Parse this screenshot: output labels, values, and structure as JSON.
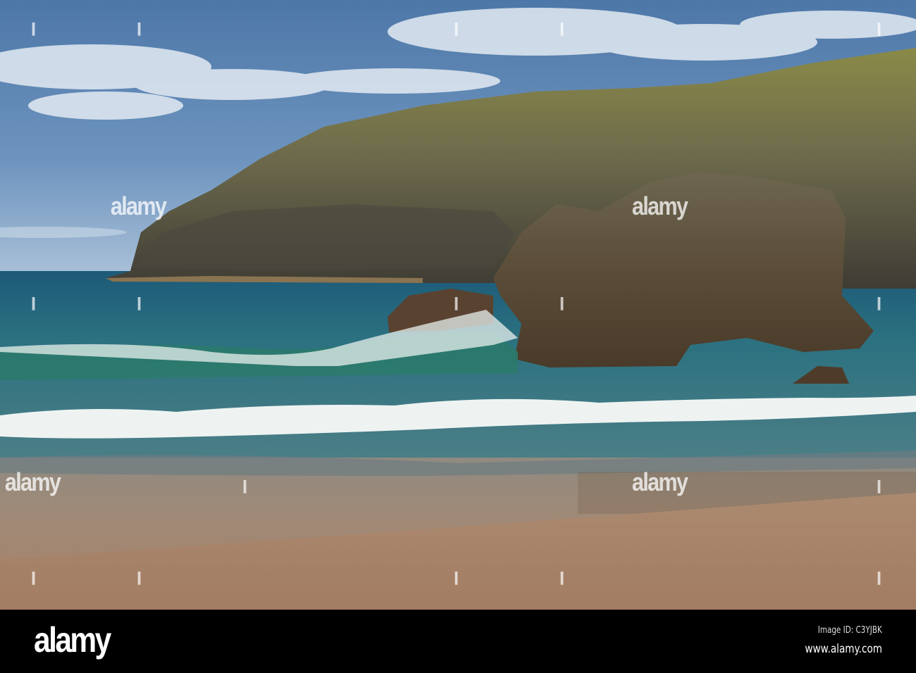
{
  "watermark": {
    "word": "alamy"
  },
  "footer": {
    "logo": "alamy",
    "image_id": "Image ID: C3YJBK",
    "url": "www.alamy.com"
  }
}
